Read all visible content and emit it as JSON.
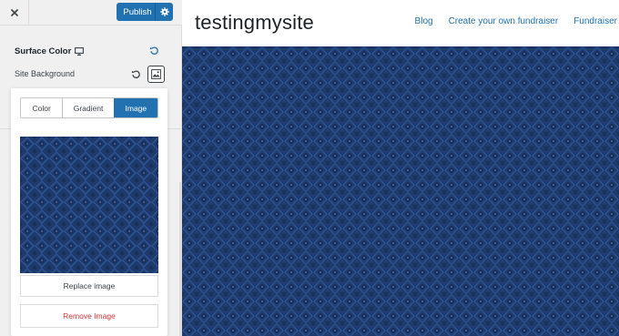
{
  "topbar": {
    "close_icon": "close-icon",
    "publish_label": "Publish",
    "publish_icon": "gear-icon"
  },
  "section": {
    "title": "Surface Color",
    "title_icon": "desktop-icon",
    "reset_icon": "undo-icon"
  },
  "background_control": {
    "label": "Site Background",
    "reset_icon": "undo-icon",
    "toggle_icon": "image-picker-icon"
  },
  "popup": {
    "tabs": [
      {
        "label": "Color",
        "active": false
      },
      {
        "label": "Gradient",
        "active": false
      },
      {
        "label": "Image",
        "active": true
      }
    ],
    "replace_label": "Replace image",
    "remove_label": "Remove Image"
  },
  "site": {
    "title": "testingmysite",
    "nav": [
      {
        "label": "Blog"
      },
      {
        "label": "Create your own fundraiser"
      },
      {
        "label": "Fundraiser"
      }
    ]
  },
  "colors": {
    "accent": "#2271b1",
    "pattern_base": "#1f3b6e",
    "pattern_light": "#2e5291",
    "pattern_dark": "#152b52",
    "danger": "#d63638"
  }
}
